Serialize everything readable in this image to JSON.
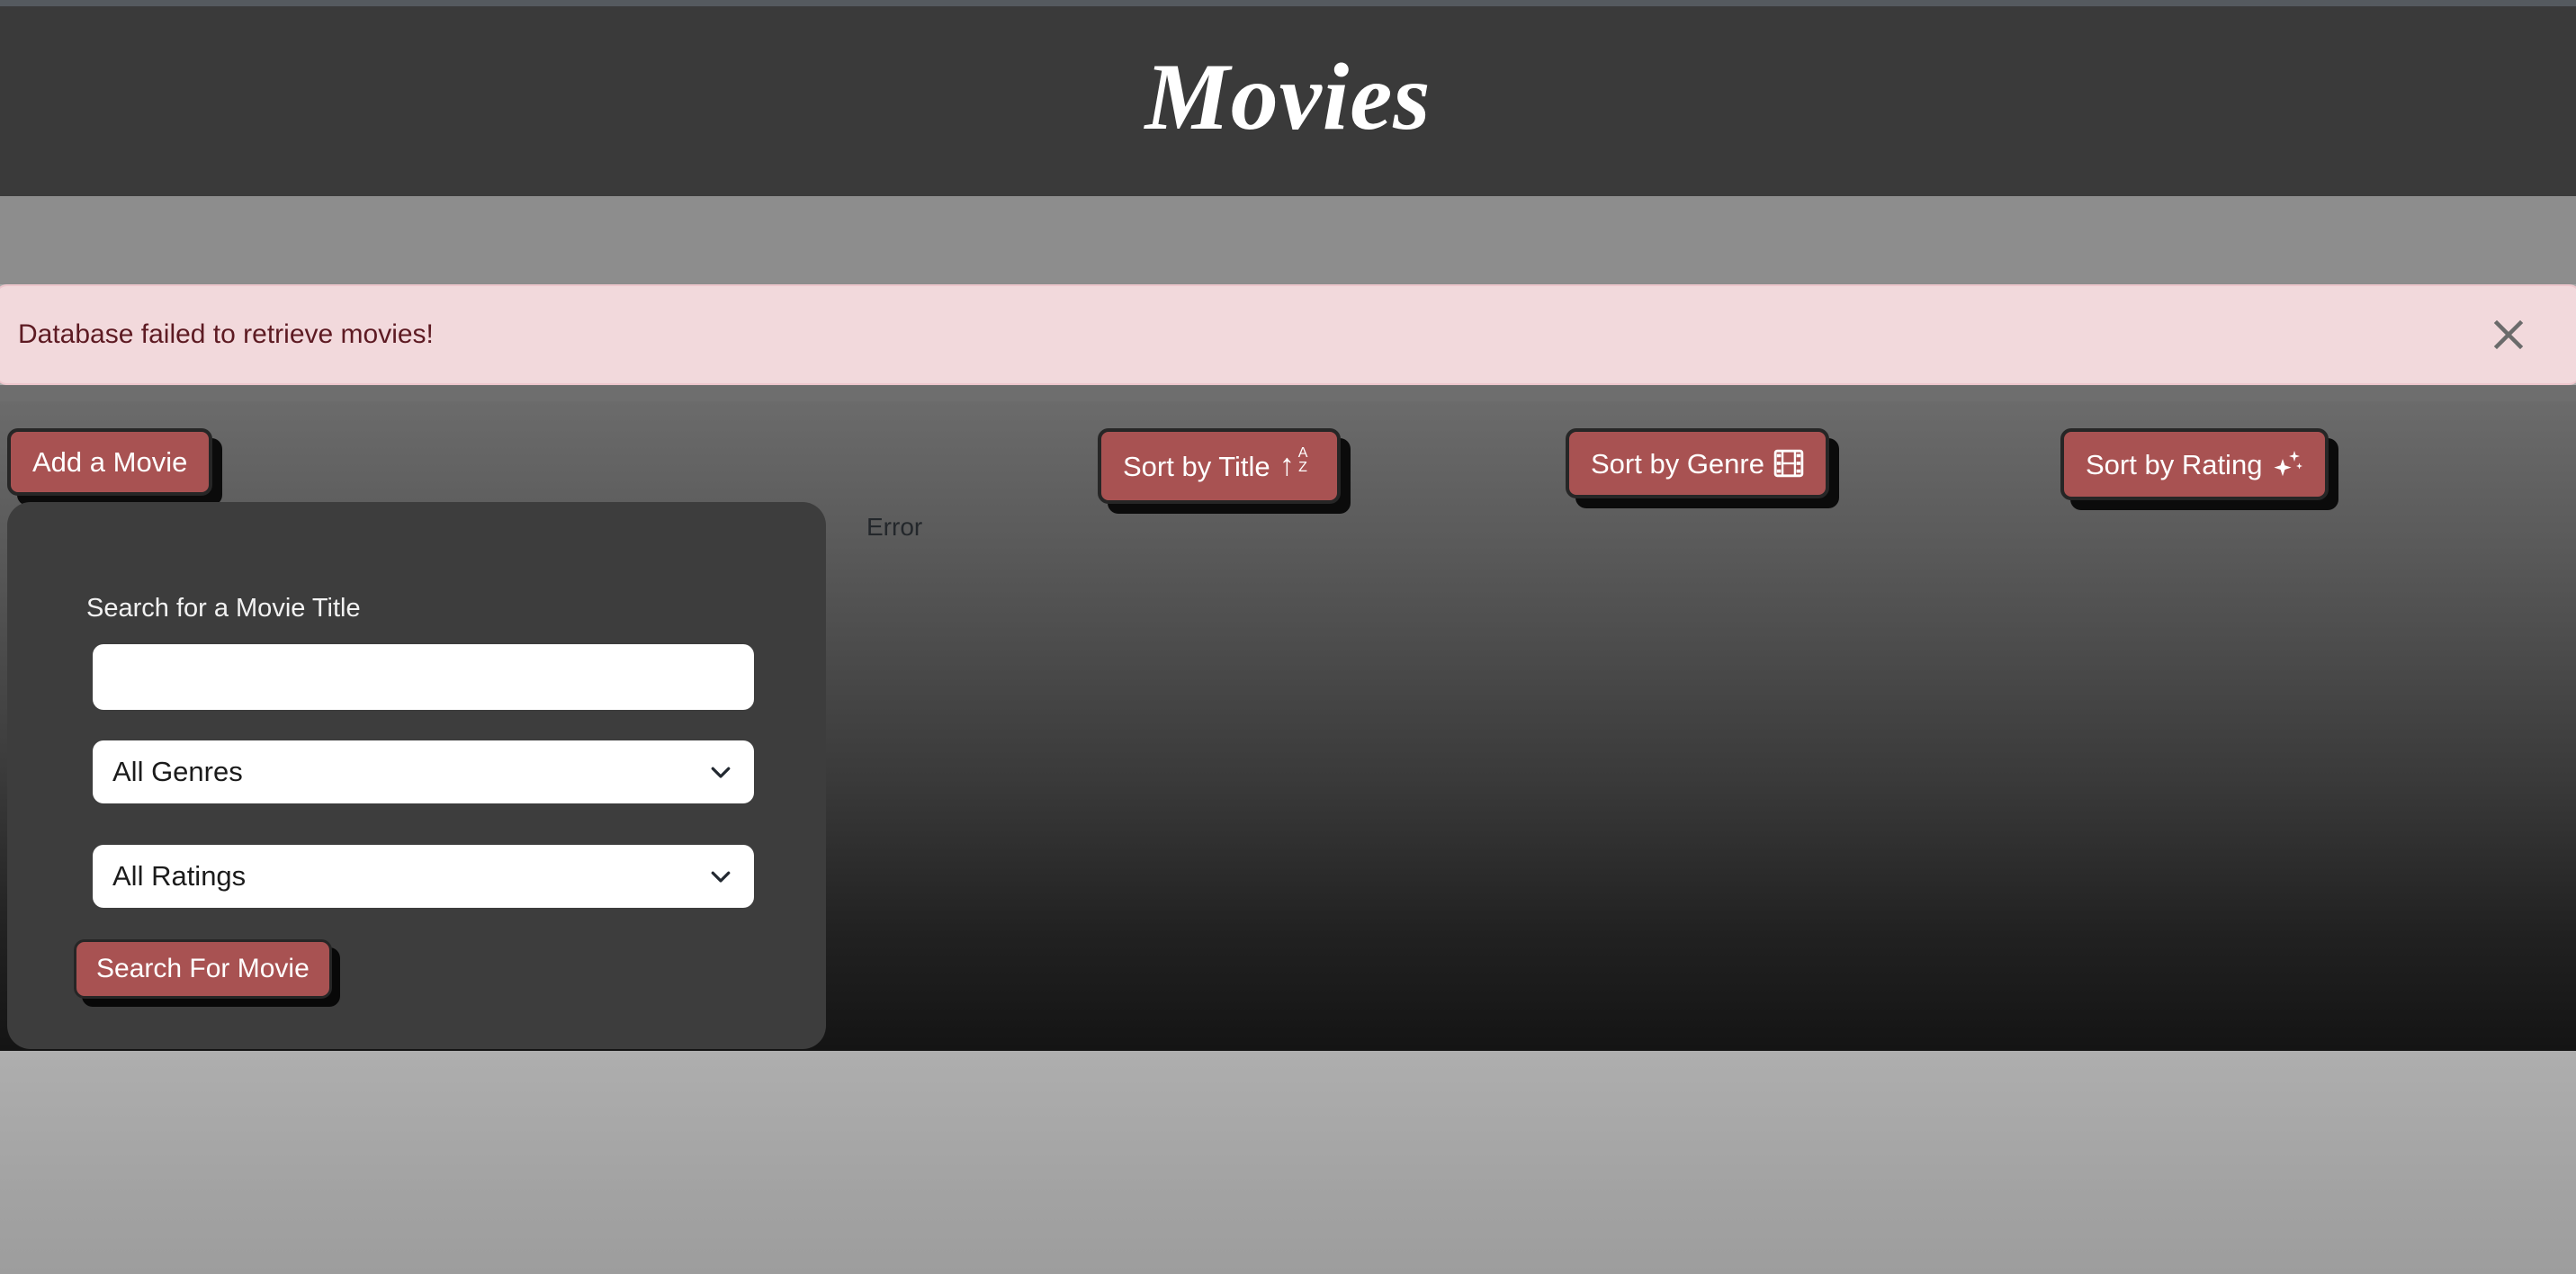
{
  "colors": {
    "accent_red": "#a85252",
    "header_bg": "#3a3a3a",
    "panel_bg": "#3d3d3d",
    "alert_bg": "#f2d9dc",
    "alert_text": "#5d1a22",
    "page_bg": "#aaaaaa"
  },
  "header": {
    "title": "Movies"
  },
  "alert": {
    "message": "Database failed to retrieve movies!",
    "close_icon": "close-icon"
  },
  "toolbar": {
    "add_movie_label": "Add a Movie",
    "sort_title_label": "Sort by Title",
    "sort_title_icon": "arrow-up-a-z-icon",
    "sort_title_icon_letters": [
      "A",
      "Z"
    ],
    "sort_title_icon_arrow": "↑",
    "sort_genre_label": "Sort by Genre",
    "sort_genre_icon": "film-strip-icon",
    "sort_rating_label": "Sort by Rating",
    "sort_rating_icon": "sparkles-icon"
  },
  "main": {
    "list_status": "Error"
  },
  "search_panel": {
    "title_label": "Search for a Movie Title",
    "title_input_value": "",
    "title_input_placeholder": "",
    "genre_select_value": "All Genres",
    "genre_select_options": [
      "All Genres"
    ],
    "rating_select_value": "All Ratings",
    "rating_select_options": [
      "All Ratings"
    ],
    "submit_label": "Search For Movie",
    "chevron_icon": "chevron-down-icon"
  }
}
